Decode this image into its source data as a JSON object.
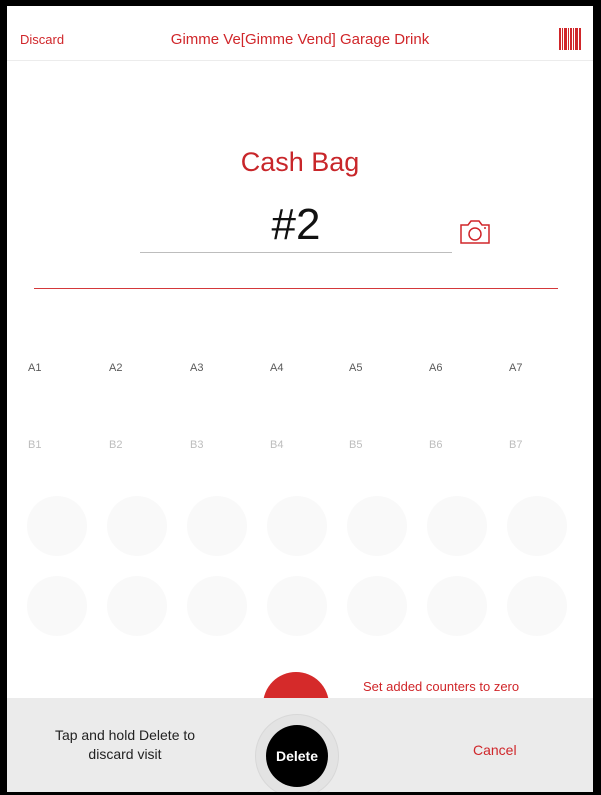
{
  "navbar": {
    "discard_label": "Discard",
    "title": "Gimme Ve[Gimme Vend] Garage Drink",
    "barcode_icon": "barcode-icon"
  },
  "main": {
    "heading": "Cash Bag",
    "bag_number": "#2",
    "camera_icon": "camera-icon"
  },
  "slots": {
    "row_a": [
      "A1",
      "A2",
      "A3",
      "A4",
      "A5",
      "A6",
      "A7"
    ],
    "row_b": [
      "B1",
      "B2",
      "B3",
      "B4",
      "B5",
      "B6",
      "B7"
    ]
  },
  "actions": {
    "zero_counters_label": "Set added counters to zero"
  },
  "bottom_panel": {
    "hint_line1": "Tap and hold Delete to",
    "hint_line2": "discard visit",
    "delete_label": "Delete",
    "cancel_label": "Cancel"
  },
  "colors": {
    "accent": "#d0262a",
    "panel": "#ebebeb"
  }
}
